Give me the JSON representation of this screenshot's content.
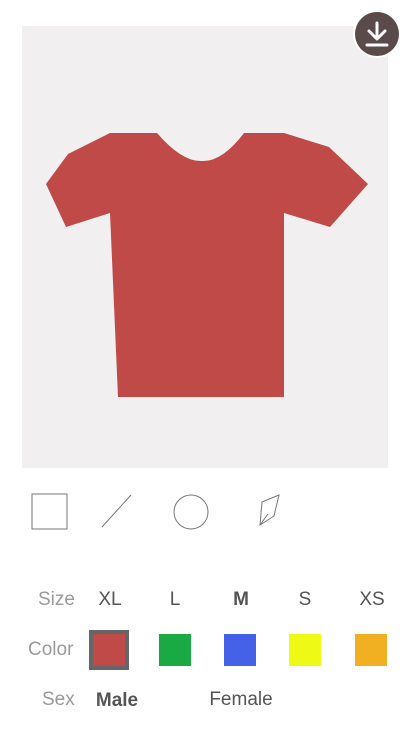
{
  "design": {
    "shirt_color": "#c04a47",
    "canvas_bg": "#f1eff0"
  },
  "icons": {
    "download": "download-icon",
    "tools": [
      "square-icon",
      "line-icon",
      "circle-icon",
      "pen-icon"
    ]
  },
  "size": {
    "label": "Size",
    "options": [
      "XL",
      "L",
      "M",
      "S",
      "XS"
    ],
    "selected": "M"
  },
  "color": {
    "label": "Color",
    "swatches": [
      "#c04a47",
      "#1aaa44",
      "#4461e8",
      "#eefa16",
      "#f0b022"
    ],
    "selected": "#c04a47"
  },
  "sex": {
    "label": "Sex",
    "options": [
      "Male",
      "Female"
    ],
    "selected": "Male"
  }
}
